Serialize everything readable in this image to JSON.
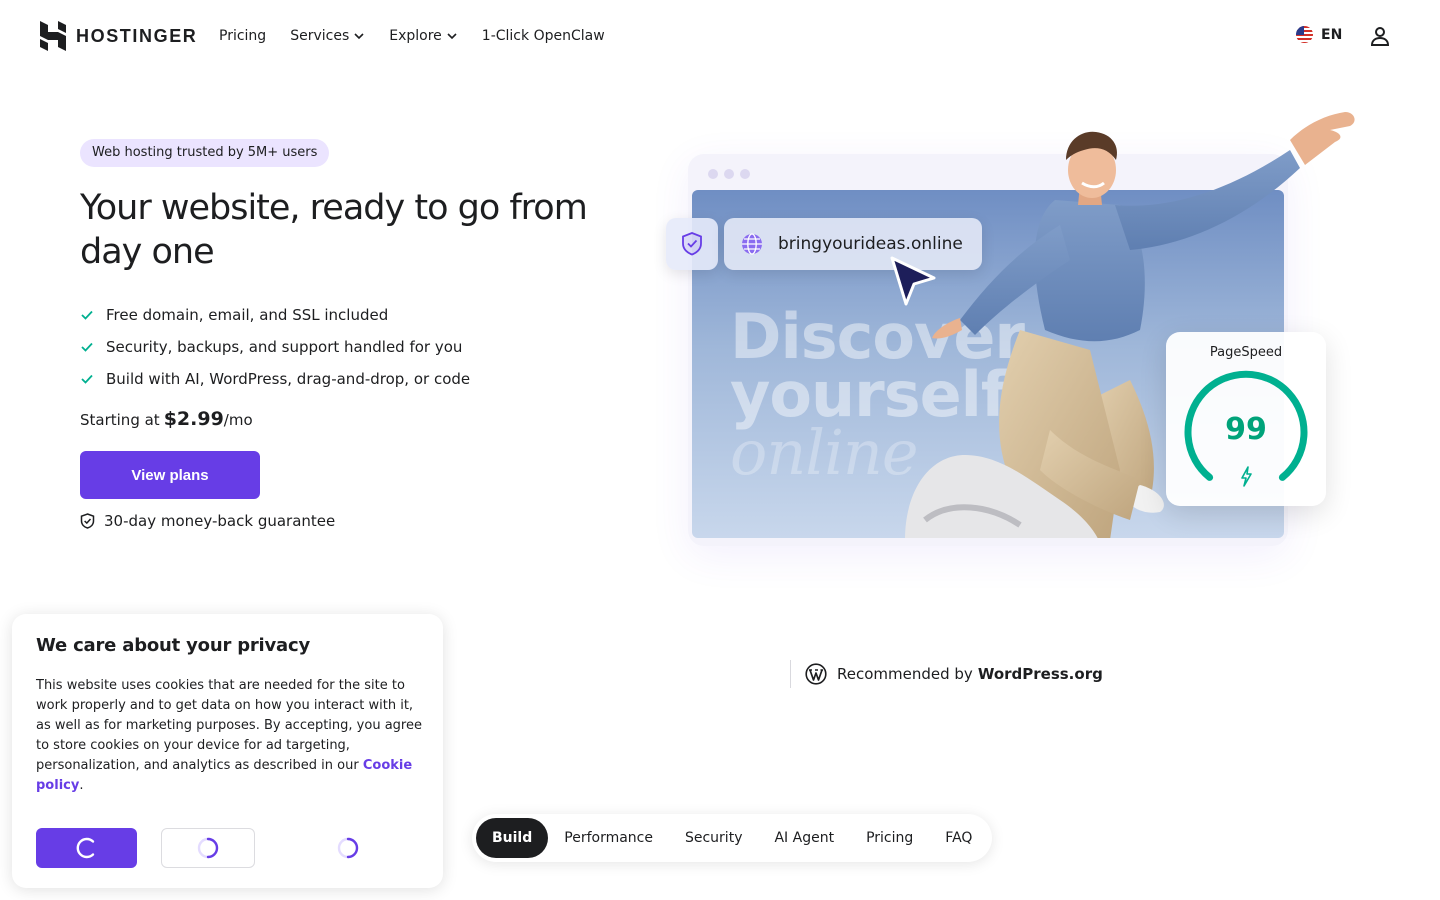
{
  "header": {
    "brand": "HOSTINGER",
    "nav": [
      {
        "label": "Pricing"
      },
      {
        "label": "Services"
      },
      {
        "label": "Explore"
      },
      {
        "label": "1-Click OpenClaw"
      }
    ],
    "language": "EN"
  },
  "hero": {
    "badge": "Web hosting trusted by 5M+ users",
    "title": "Your website, ready to go from day one",
    "features": [
      "Free domain, email, and SSL included",
      "Security, backups, and support handled for you",
      "Build with AI, WordPress, drag-and-drop, or code"
    ],
    "price_prefix": "Starting at",
    "price_amount": "$2.99",
    "price_suffix": "/mo",
    "cta_label": "View plans",
    "guarantee": "30-day money-back guarantee"
  },
  "illustration": {
    "url": "bringyourideas.online",
    "headline_line1": "Discover",
    "headline_line2": "yourself",
    "headline_line3": "online",
    "pagespeed_label": "PageSpeed",
    "pagespeed_score": "99",
    "pagespeed_fraction": 0.99
  },
  "recommended": {
    "prefix": "Recommended by",
    "org": "WordPress.org"
  },
  "cookie_banner": {
    "title": "We care about your privacy",
    "body": "This website uses cookies that are needed for the site to work properly and to get data on how you interact with it, as well as for marketing purposes. By accepting, you agree to store cookies on your device for ad targeting, personalization, and analytics as described in our",
    "link": "Cookie policy",
    "link_suffix": "."
  },
  "section_tabs": [
    {
      "label": "Build",
      "active": true
    },
    {
      "label": "Performance",
      "active": false
    },
    {
      "label": "Security",
      "active": false
    },
    {
      "label": "AI Agent",
      "active": false
    },
    {
      "label": "Pricing",
      "active": false
    },
    {
      "label": "FAQ",
      "active": false
    }
  ],
  "colors": {
    "brand": "#673de6",
    "text": "#1d1e20",
    "success": "#00b090",
    "badge_bg": "#ebe4ff"
  }
}
